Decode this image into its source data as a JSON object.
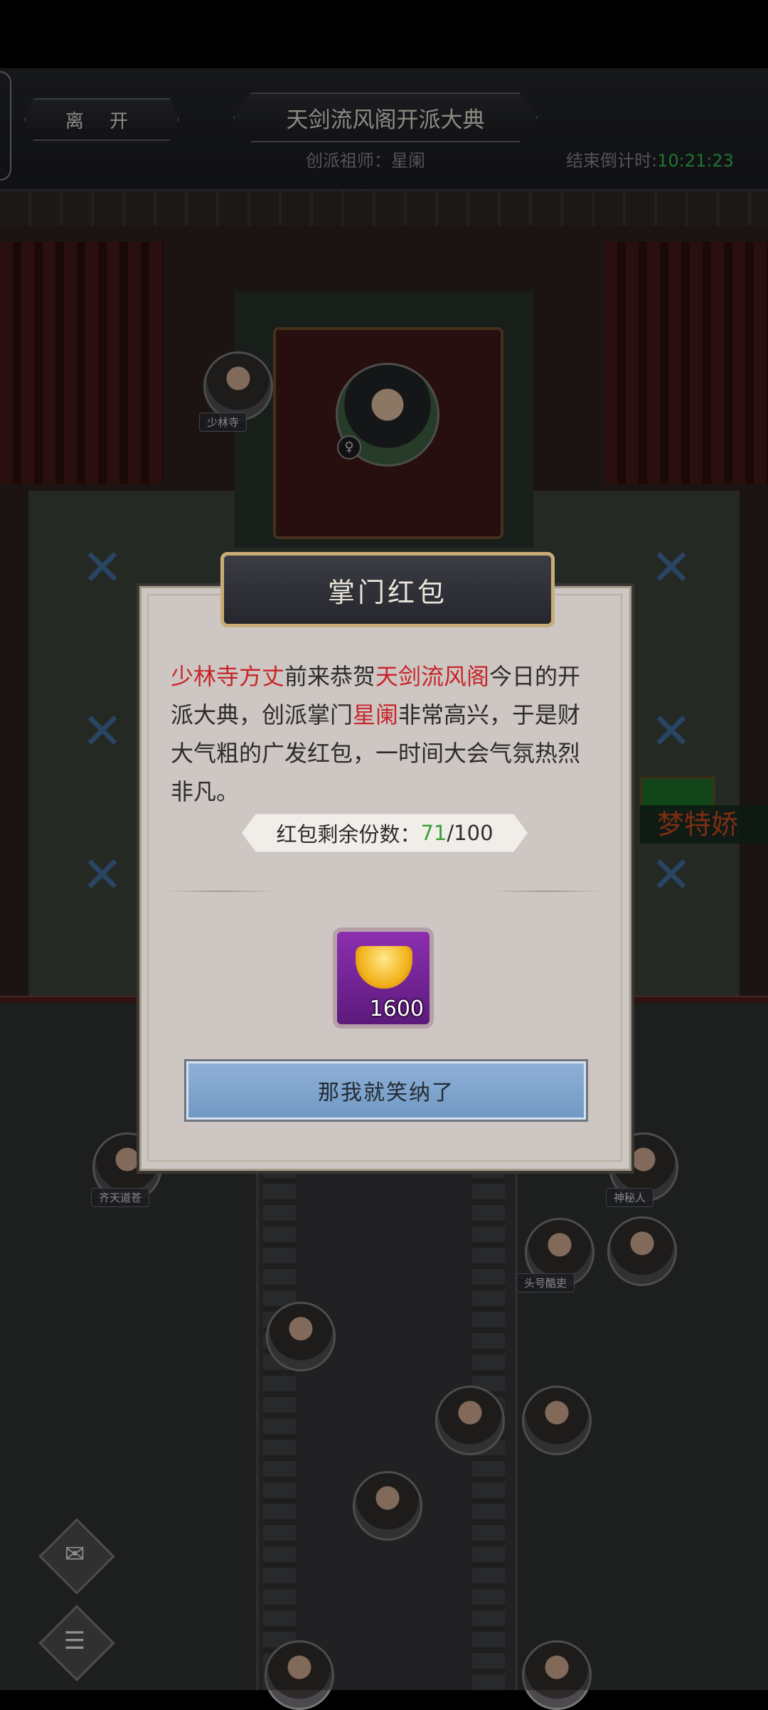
{
  "header": {
    "leave_label": "离 开",
    "title": "天剑流风阁开派大典",
    "founder_label": "创派祖师：星阑",
    "countdown_label": "结束倒计时:",
    "countdown_time": "10:21:23"
  },
  "hall": {
    "guests": [
      {
        "name": "少林寺"
      },
      {
        "name": "齐天道苍"
      },
      {
        "name": "神秘人"
      },
      {
        "name": "头号酷吏"
      }
    ],
    "banner_name": "梦特娇"
  },
  "dialog": {
    "title": "掌门红包",
    "message": {
      "part1": "少林寺方丈",
      "part2": "前来恭贺",
      "part3": "天剑流风阁",
      "part4": "今日的开派大典，创派掌门",
      "part5": "星阑",
      "part6": "非常高兴，于是财大气粗的广发红包，一时间大会气氛热烈非凡。"
    },
    "remaining_label": "红包剩余份数：",
    "remaining_current": "71",
    "remaining_total": "/100",
    "reward_count": "1600",
    "accept_label": "那我就笑纳了"
  },
  "colors": {
    "highlight": "#c7252a",
    "countdown": "#2fb64a",
    "button": "#8eb0d6"
  }
}
